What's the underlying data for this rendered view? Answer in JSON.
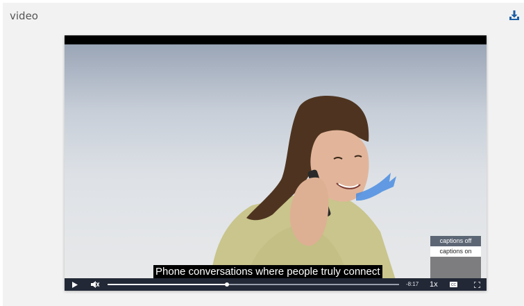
{
  "panel": {
    "title": "video"
  },
  "player": {
    "caption_text": "Phone conversations where people truly connect",
    "captions_menu": {
      "off_label": "captions off",
      "on_label": "captions on"
    },
    "controls": {
      "time_remaining": "-8:17",
      "playback_rate": "1x",
      "cc_label": "CC",
      "progress": 0.41
    }
  },
  "icons": [
    "download-icon",
    "play-icon",
    "mute-icon",
    "captions-icon",
    "fullscreen-icon"
  ]
}
